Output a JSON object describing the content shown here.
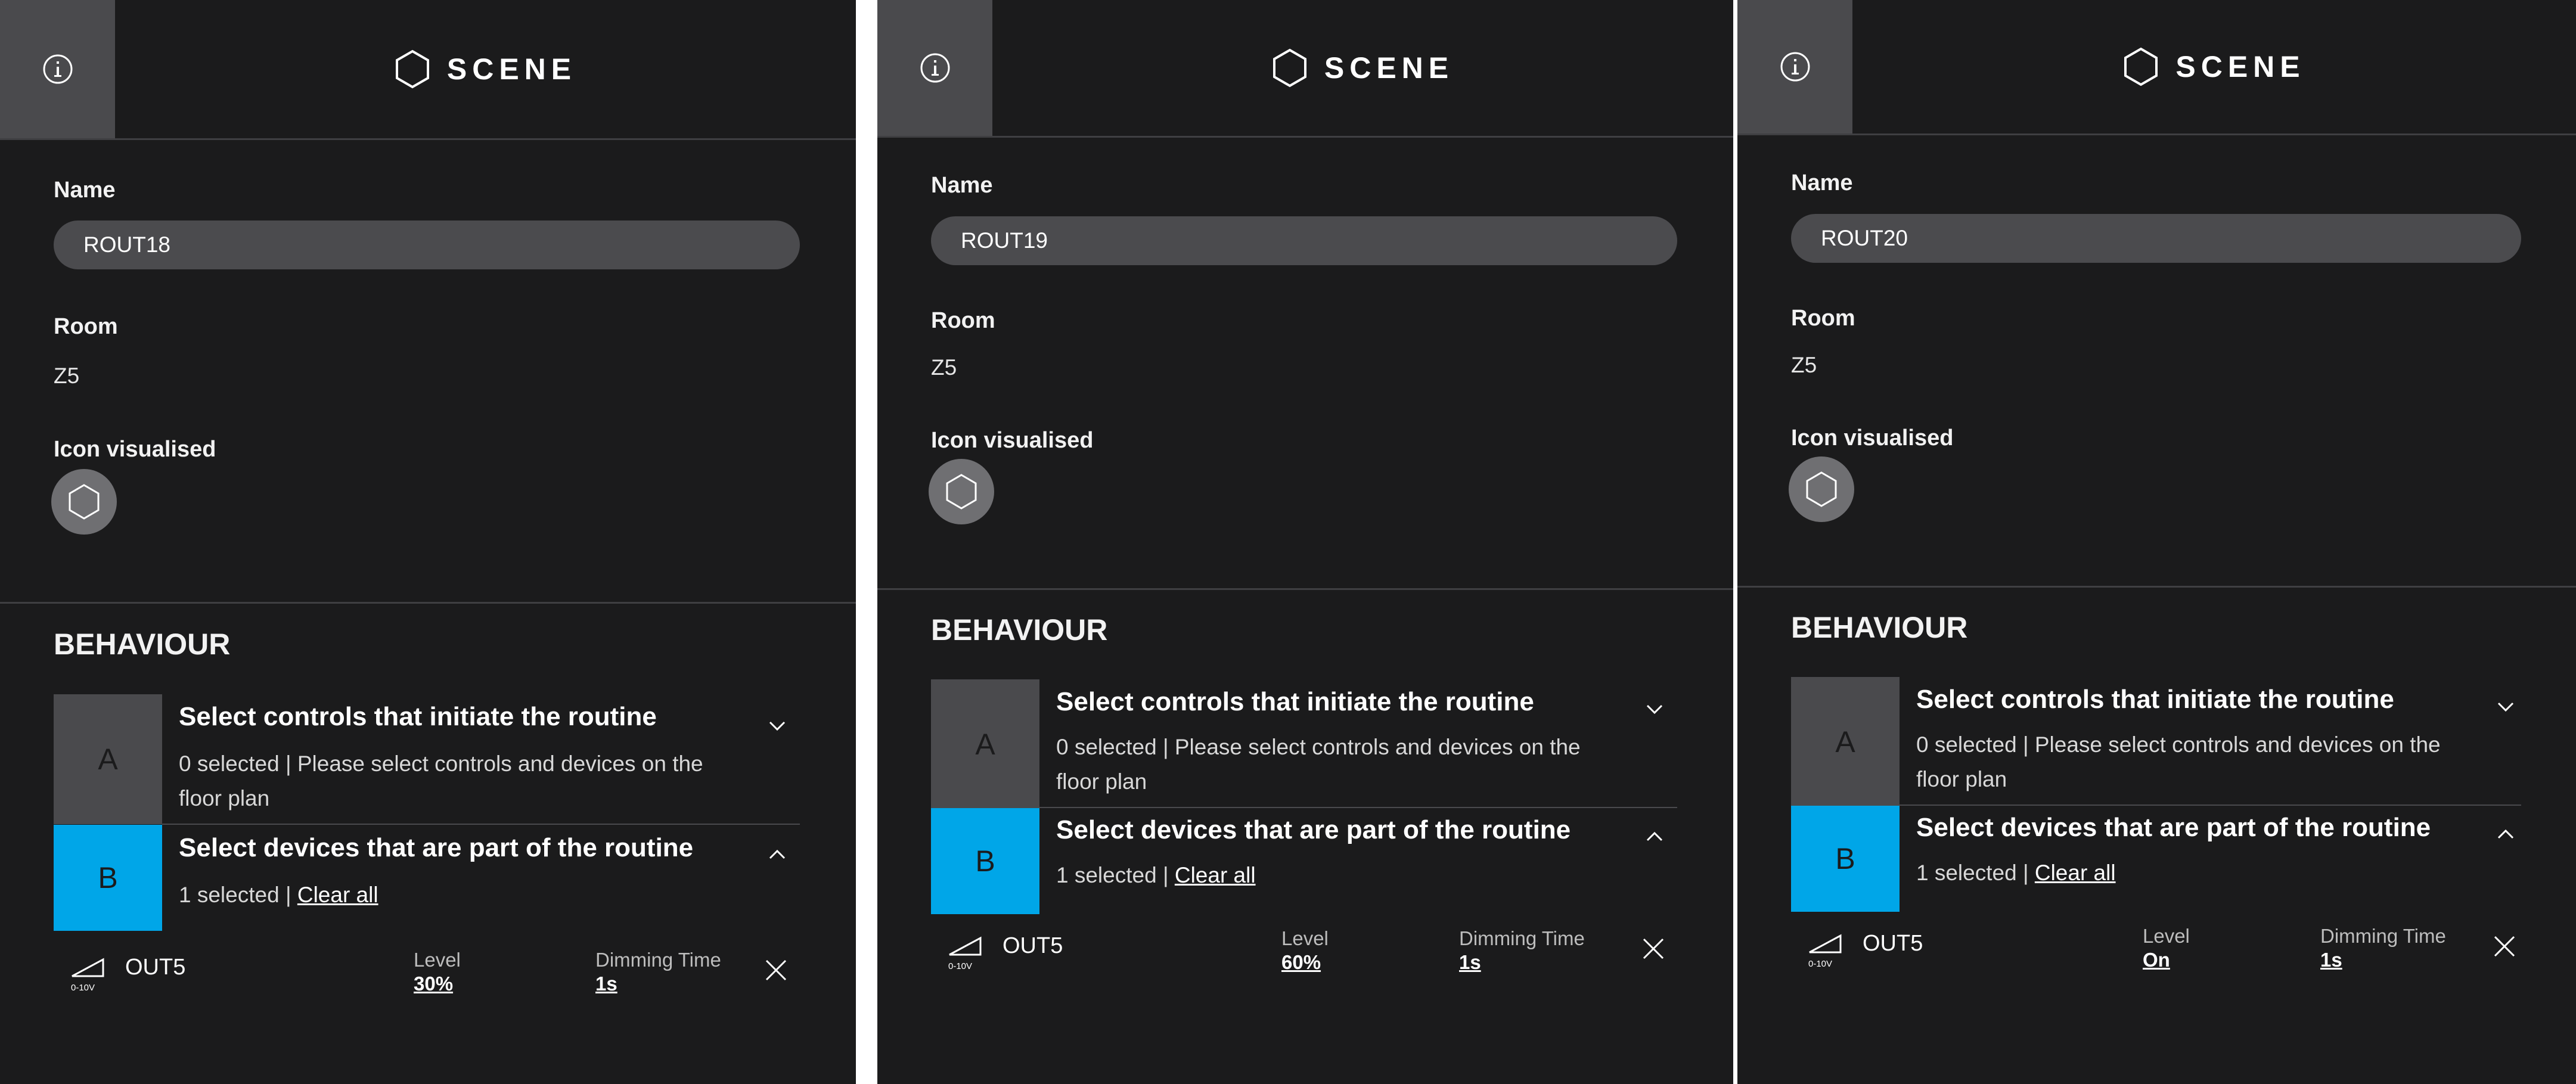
{
  "common": {
    "title": "SCENE",
    "name_label": "Name",
    "room_label": "Room",
    "icon_label": "Icon visualised",
    "behaviour_heading": "BEHAVIOUR",
    "step_a_letter": "A",
    "step_b_letter": "B",
    "controls_title": "Select controls that initiate the routine",
    "controls_sub": "0 selected | Please select controls and devices on the floor plan",
    "devices_title": "Select devices that are part of the routine",
    "devices_selected": "1 selected | ",
    "clear_all": "Clear all",
    "level_label": "Level",
    "dimming_label": "Dimming Time",
    "device_type_caption": "0-10V"
  },
  "colors": {
    "panel_bg": "#1b1b1c",
    "accent_b": "#00a6e8",
    "input_bg": "#4b4b4e"
  },
  "panels": [
    {
      "name": "ROUT18",
      "room": "Z5",
      "device": "OUT5",
      "level": "30%",
      "dimming": "1s"
    },
    {
      "name": "ROUT19",
      "room": "Z5",
      "device": "OUT5",
      "level": "60%",
      "dimming": "1s"
    },
    {
      "name": "ROUT20",
      "room": "Z5",
      "device": "OUT5",
      "level": "On",
      "dimming": "1s"
    }
  ]
}
